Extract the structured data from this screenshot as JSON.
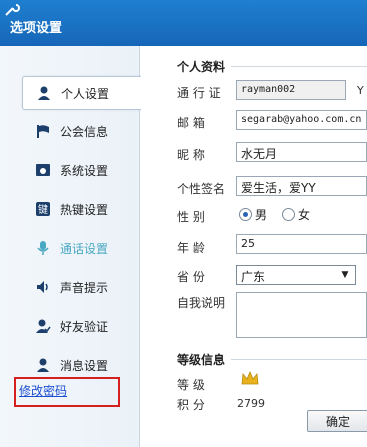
{
  "window": {
    "title": "选项设置"
  },
  "sidebar": {
    "items": [
      {
        "label": "个人设置",
        "icon": "person-icon",
        "active": true
      },
      {
        "label": "公会信息",
        "icon": "flag-icon"
      },
      {
        "label": "系统设置",
        "icon": "system-icon"
      },
      {
        "label": "热键设置",
        "icon": "hotkey-icon"
      },
      {
        "label": "通话设置",
        "icon": "microphone-icon"
      },
      {
        "label": "声音提示",
        "icon": "speaker-icon"
      },
      {
        "label": "好友验证",
        "icon": "verify-icon"
      },
      {
        "label": "消息设置",
        "icon": "message-icon"
      }
    ],
    "change_password": "修改密码"
  },
  "profile": {
    "title": "个人资料",
    "passport_label": "通 行 证",
    "passport_value": "rayman002",
    "passport_suffix": "Y",
    "email_label": "邮    箱",
    "email_value": "segarab@yahoo.com.cn",
    "nickname_label": "昵    称",
    "nickname_value": "水无月",
    "signature_label": "个性签名",
    "signature_value": "爱生活，爱YY",
    "gender_label": "性    别",
    "gender_male": "男",
    "gender_female": "女",
    "gender_selected": "男",
    "age_label": "年    龄",
    "age_value": "25",
    "province_label": "省    份",
    "province_value": "广东",
    "about_label": "自我说明",
    "about_value": ""
  },
  "level": {
    "title": "等级信息",
    "level_label": "等    级",
    "points_label": "积    分",
    "points_value": "2799"
  },
  "footer": {
    "ok_button": "确定"
  },
  "colors": {
    "titlebar": "#1a70c4",
    "link": "#1b4fd0",
    "highlight_border": "#d62020",
    "crown": "#e8b21c"
  }
}
